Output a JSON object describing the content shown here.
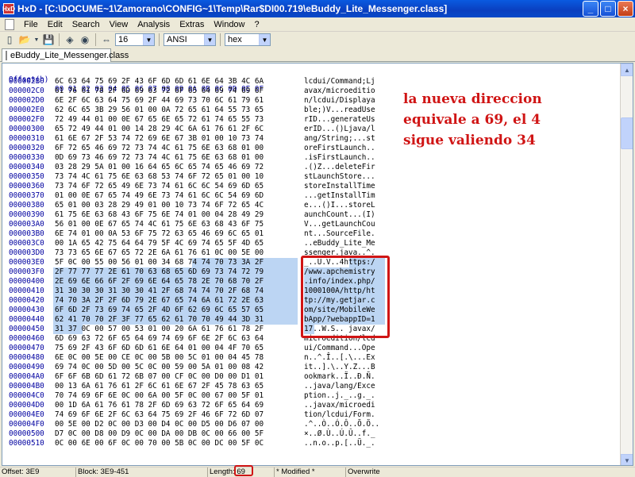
{
  "window": {
    "app_icon": "HxD",
    "title": "HxD - [C:\\DOCUME~1\\Zamorano\\CONFIG~1\\Temp\\Rar$DI00.719\\eBuddy_Lite_Messenger.class]",
    "minimize": "_",
    "maximize": "□",
    "close": "×"
  },
  "menu": [
    "File",
    "Edit",
    "Search",
    "View",
    "Analysis",
    "Extras",
    "Window",
    "?"
  ],
  "toolbar": {
    "bytes_per_row": "16",
    "charset": "ANSI",
    "display": "hex",
    "icons": [
      "new-icon",
      "open-icon",
      "save-icon",
      "ram-icon",
      "disk-icon"
    ]
  },
  "tab": {
    "label": "eBuddy_Lite_Messenger.class"
  },
  "header": {
    "offset": "Offset(h)",
    "columns": "00 01 02 03 04 05 06 07 08 09 0A 0B 0C 0D 0E 0F"
  },
  "rows": [
    {
      "off": "000002B0",
      "hex": "6C 63 64 75 69 2F 43 6F 6D 6D 61 6E 64 3B 4C 6A",
      "asc": "lcdui/Command;Lj"
    },
    {
      "off": "000002C0",
      "hex": "61 76 61 78 2F 6D 69 63 72 6F 65 64 69 74 69 6F",
      "asc": "avax/microeditio"
    },
    {
      "off": "000002D0",
      "hex": "6E 2F 6C 63 64 75 69 2F 44 69 73 70 6C 61 79 61",
      "asc": "n/lcdui/Displaya"
    },
    {
      "off": "000002E0",
      "hex": "62 6C 65 3B 29 56 01 00 0A 72 65 61 64 55 73 65",
      "asc": "ble;)V...readUse"
    },
    {
      "off": "000002F0",
      "hex": "72 49 44 01 00 0E 67 65 6E 65 72 61 74 65 55 73",
      "asc": "rID...generateUs"
    },
    {
      "off": "00000300",
      "hex": "65 72 49 44 01 00 14 28 29 4C 6A 61 76 61 2F 6C",
      "asc": "erID...()Ljava/l"
    },
    {
      "off": "00000310",
      "hex": "61 6E 67 2F 53 74 72 69 6E 67 3B 01 00 10 73 74",
      "asc": "ang/String;...st"
    },
    {
      "off": "00000320",
      "hex": "6F 72 65 46 69 72 73 74 4C 61 75 6E 63 68 01 00",
      "asc": "oreFirstLaunch.."
    },
    {
      "off": "00000330",
      "hex": "0D 69 73 46 69 72 73 74 4C 61 75 6E 63 68 01 00",
      "asc": ".isFirstLaunch.."
    },
    {
      "off": "00000340",
      "hex": "03 28 29 5A 01 00 16 64 65 6C 65 74 65 46 69 72",
      "asc": ".()Z...deleteFir"
    },
    {
      "off": "00000350",
      "hex": "73 74 4C 61 75 6E 63 68 53 74 6F 72 65 01 00 10",
      "asc": "stLaunchStore..."
    },
    {
      "off": "00000360",
      "hex": "73 74 6F 72 65 49 6E 73 74 61 6C 6C 54 69 6D 65",
      "asc": "storeInstallTime"
    },
    {
      "off": "00000370",
      "hex": "01 00 0E 67 65 74 49 6E 73 74 61 6C 6C 54 69 6D",
      "asc": "...getInstallTim"
    },
    {
      "off": "00000380",
      "hex": "65 01 00 03 28 29 49 01 00 10 73 74 6F 72 65 4C",
      "asc": "e...()I...storeL"
    },
    {
      "off": "00000390",
      "hex": "61 75 6E 63 68 43 6F 75 6E 74 01 00 04 28 49 29",
      "asc": "aunchCount...(I)"
    },
    {
      "off": "000003A0",
      "hex": "56 01 00 0E 67 65 74 4C 61 75 6E 63 68 43 6F 75",
      "asc": "V...getLaunchCou"
    },
    {
      "off": "000003B0",
      "hex": "6E 74 01 00 0A 53 6F 75 72 63 65 46 69 6C 65 01",
      "asc": "nt...SourceFile."
    },
    {
      "off": "000003C0",
      "hex": "00 1A 65 42 75 64 64 79 5F 4C 69 74 65 5F 4D 65",
      "asc": "..eBuddy_Lite_Me"
    },
    {
      "off": "000003D0",
      "hex": "73 73 65 6E 67 65 72 2E 6A 61 76 61 0C 00 5E 00",
      "asc": "ssenger.java..^."
    },
    {
      "off": "000003E0",
      "hex": "5F 0C 00 55 00 56 01 00 34 68 74 74 70 73 3A 2F",
      "asc": "_..U.V..4https:/"
    },
    {
      "off": "000003F0",
      "hex": "2F 77 77 77 2E 61 70 63 68 65 6D 69 73 74 72 79",
      "asc": "/www.apchemistry"
    },
    {
      "off": "00000400",
      "hex": "2E 69 6E 66 6F 2F 69 6E 64 65 78 2E 70 68 70 2F",
      "asc": ".info/index.php/"
    },
    {
      "off": "00000410",
      "hex": "31 30 30 30 31 30 30 41 2F 68 74 74 70 2F 68 74",
      "asc": "1000100A/http/ht"
    },
    {
      "off": "00000420",
      "hex": "74 70 3A 2F 2F 6D 79 2E 67 65 74 6A 61 72 2E 63",
      "asc": "tp://my.getjar.c"
    },
    {
      "off": "00000430",
      "hex": "6F 6D 2F 73 69 74 65 2F 4D 6F 62 69 6C 65 57 65",
      "asc": "om/site/MobileWe"
    },
    {
      "off": "00000440",
      "hex": "62 41 70 70 2F 3F 77 65 62 61 70 70 49 44 3D 31",
      "asc": "bApp/?webappID=1"
    },
    {
      "off": "00000450",
      "hex": "31 37 0C 00 57 00 53 01 00 20 6A 61 76 61 78 2F",
      "asc": "17..W.S.. javax/"
    },
    {
      "off": "00000460",
      "hex": "6D 69 63 72 6F 65 64 69 74 69 6F 6E 2F 6C 63 64",
      "asc": "microedition/lcd"
    },
    {
      "off": "00000470",
      "hex": "75 69 2F 43 6F 6D 6D 61 6E 64 01 00 04 4F 70 65",
      "asc": "ui/Command...Ope"
    },
    {
      "off": "00000480",
      "hex": "6E 0C 00 5E 00 CE 0C 00 5B 00 5C 01 00 04 45 78",
      "asc": "n..^.Î..[.\\...Ex"
    },
    {
      "off": "00000490",
      "hex": "69 74 0C 00 5D 00 5C 0C 00 59 00 5A 01 00 08 42",
      "asc": "it..].\\..Y.Z...B"
    },
    {
      "off": "000004A0",
      "hex": "6F 6F 6B 6D 61 72 6B 07 00 CF 0C 00 D0 00 D1 01",
      "asc": "ookmark..Ï..Ð.Ñ."
    },
    {
      "off": "000004B0",
      "hex": "00 13 6A 61 76 61 2F 6C 61 6E 67 2F 45 78 63 65",
      "asc": "..java/lang/Exce"
    },
    {
      "off": "000004C0",
      "hex": "70 74 69 6F 6E 0C 00 6A 00 5F 0C 00 67 00 5F 01",
      "asc": "ption..j._..g._."
    },
    {
      "off": "000004D0",
      "hex": "00 1D 6A 61 76 61 78 2F 6D 69 63 72 6F 65 64 69",
      "asc": "..javax/microedi"
    },
    {
      "off": "000004E0",
      "hex": "74 69 6F 6E 2F 6C 63 64 75 69 2F 46 6F 72 6D 07",
      "asc": "tion/lcdui/Form."
    },
    {
      "off": "000004F0",
      "hex": "00 5E 00 D2 0C 00 D3 00 D4 0C 00 D5 00 D6 07 00",
      "asc": ".^..Ò..Ó.Ô..Õ.Ö.."
    },
    {
      "off": "00000500",
      "hex": "D7 0C 00 D8 00 D9 0C 00 DA 00 DB 0C 00 66 00 5F",
      "asc": "×..Ø.Ù..Ú.Û..f._"
    },
    {
      "off": "00000510",
      "hex": "0C 00 6E 00 6F 0C 00 70 00 5B 0C 00 DC 00 5F 0C",
      "asc": "..n.o..p.[..Ü._."
    }
  ],
  "annotation": "la nueva direccion\nequivale a 69, el 4\nsigue valiendo 34",
  "status": {
    "offset": "Offset: 3E9",
    "block": "Block: 3E9-451",
    "length_label": "Length:",
    "length_value": "69",
    "modified": "* Modified *",
    "mode": "Overwrite"
  }
}
